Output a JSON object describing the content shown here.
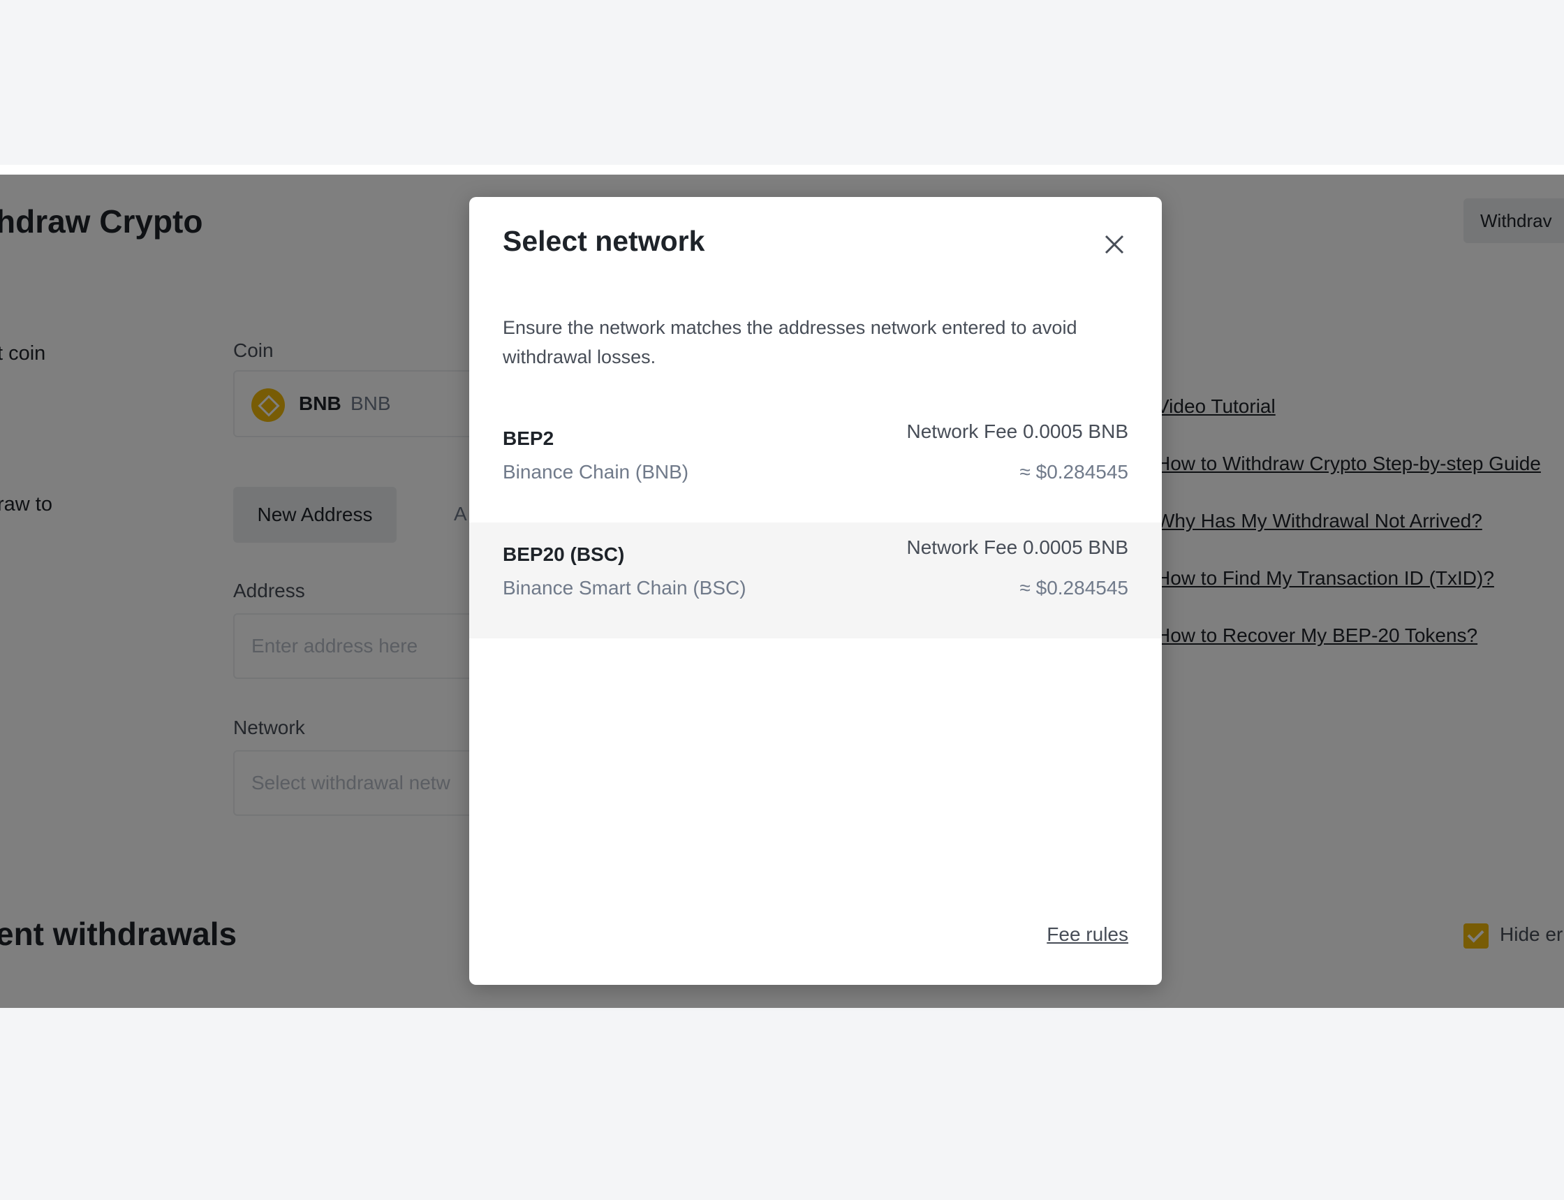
{
  "page": {
    "title": "hdraw Crypto",
    "withdraw_button": "Withdrav",
    "coin_row_label": "t coin",
    "withdraw_to_label": "raw to",
    "coin_field_label": "Coin",
    "coin": {
      "symbol": "BNB",
      "name": "BNB"
    },
    "tabs": {
      "new_address": "New Address",
      "other": "A"
    },
    "address_label": "Address",
    "address_placeholder": "Enter address here",
    "network_label": "Network",
    "network_placeholder": "Select withdrawal netw",
    "help_links": [
      "Video Tutorial",
      "How to Withdraw Crypto Step-by-step Guide",
      "Why Has My Withdrawal Not Arrived?",
      "How to Find My Transaction ID (TxID)?",
      "How to Recover My BEP-20 Tokens?"
    ],
    "recent_title": "ent withdrawals",
    "hide_label": "Hide er"
  },
  "modal": {
    "title": "Select network",
    "description": "Ensure the network matches the addresses network entered to avoid withdrawal losses.",
    "networks": [
      {
        "name": "BEP2",
        "chain": "Binance Chain (BNB)",
        "fee": "Network Fee 0.0005 BNB",
        "usd": "≈ $0.284545"
      },
      {
        "name": "BEP20 (BSC)",
        "chain": "Binance Smart Chain (BSC)",
        "fee": "Network Fee 0.0005 BNB",
        "usd": "≈ $0.284545"
      }
    ],
    "fee_rules": "Fee rules"
  },
  "colors": {
    "accent": "#f0b90b",
    "overlay": "rgba(0,0,0,0.5)",
    "text": "#1e2329"
  }
}
